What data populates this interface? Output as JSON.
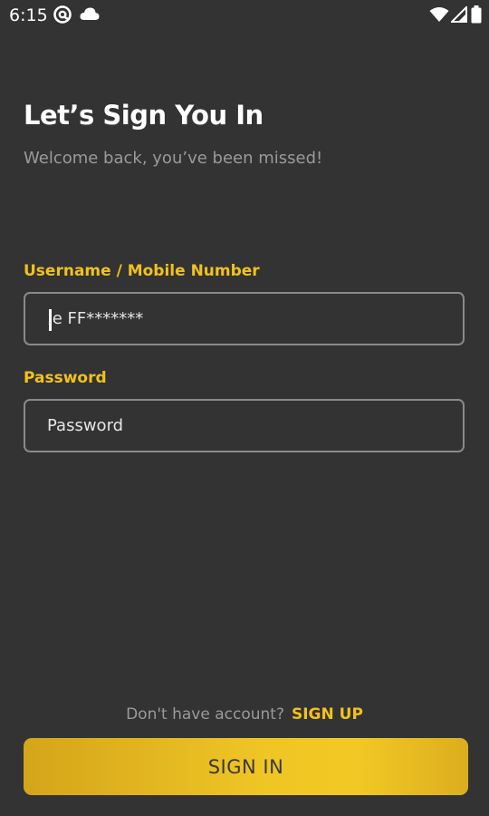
{
  "status_bar": {
    "time": "6:15",
    "icons": [
      "at-sign-icon",
      "cloud-icon",
      "wifi-icon",
      "signal-icon",
      "battery-icon"
    ]
  },
  "header": {
    "title": "Let’s Sign You In",
    "subtitle": "Welcome back, you’ve been missed!"
  },
  "form": {
    "username": {
      "label": "Username / Mobile Number",
      "value": ".e FF*******",
      "placeholder": ""
    },
    "password": {
      "label": "Password",
      "value": "",
      "placeholder": "Password"
    }
  },
  "footer": {
    "signup_prompt": "Don't have account?",
    "signup_link": "SIGN UP",
    "signin_button": "SIGN IN"
  },
  "colors": {
    "background": "#333333",
    "accent": "#f2c21c",
    "muted_text": "#9a9a9a"
  }
}
